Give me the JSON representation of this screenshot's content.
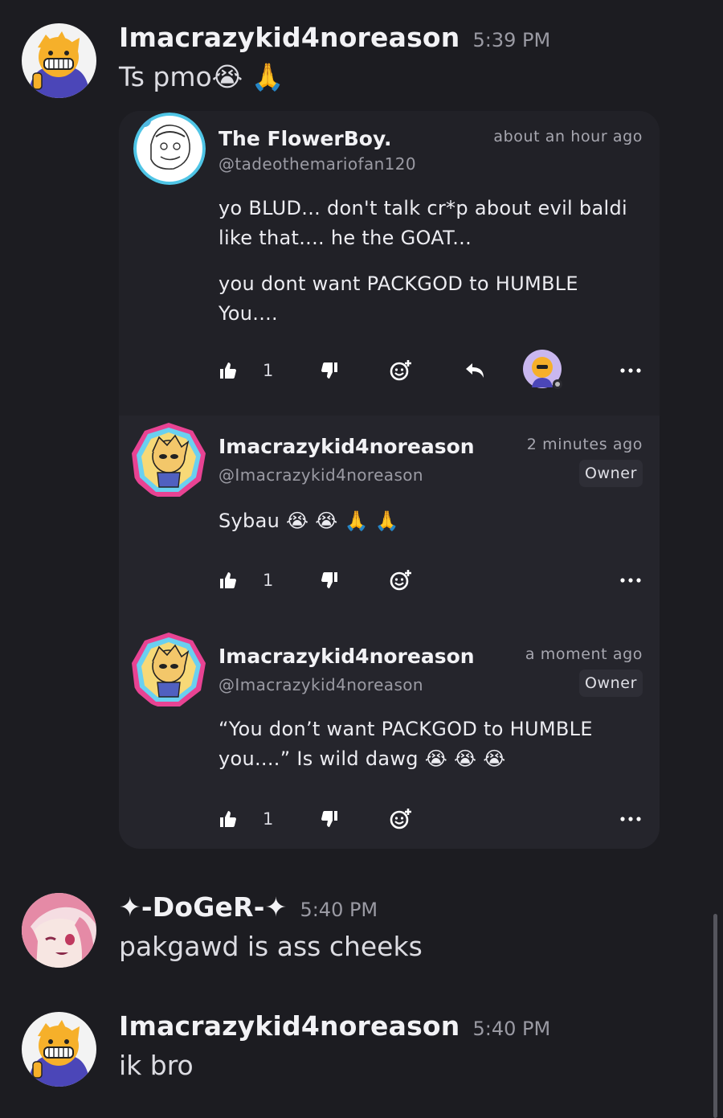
{
  "messages": [
    {
      "author": "Imacrazykid4noreason",
      "time": "5:39 PM",
      "text": "Ts pmo😭 🙏"
    },
    {
      "author": "✦-DoGeR-✦",
      "time": "5:40 PM",
      "text": "pakgawd is ass cheeks"
    },
    {
      "author": "Imacrazykid4noreason",
      "time": "5:40 PM",
      "text": "ik bro"
    }
  ],
  "embed": {
    "comments": [
      {
        "author": "The FlowerBoy.",
        "handle": "@tadeothemariofan120",
        "time": "about an hour ago",
        "paragraphs": [
          "yo BLUD... don't talk cr*p about evil baldi like that.... he the GOAT...",
          "you dont want PACKGOD to HUMBLE You...."
        ],
        "likes": "1"
      },
      {
        "author": "Imacrazykid4noreason",
        "handle": "@Imacrazykid4noreason",
        "time": "2 minutes ago",
        "badge": "Owner",
        "paragraphs": [
          "Sybau 😭 😭 🙏 🙏"
        ],
        "likes": "1"
      },
      {
        "author": "Imacrazykid4noreason",
        "handle": "@Imacrazykid4noreason",
        "time": "a moment ago",
        "badge": "Owner",
        "paragraphs": [
          "“You don’t want PACKGOD to HUMBLE you....” Is wild dawg 😭 😭 😭"
        ],
        "likes": "1"
      }
    ]
  },
  "icons": {
    "like": "thumbs-up-icon",
    "dislike": "thumbs-down-icon",
    "react": "add-reaction-icon",
    "reply": "reply-icon",
    "more": "more-options-icon"
  },
  "colors": {
    "background": "#1c1c21",
    "embed": "#25252c",
    "embed_top": "#212127",
    "muted_text": "#9a9aa3"
  }
}
